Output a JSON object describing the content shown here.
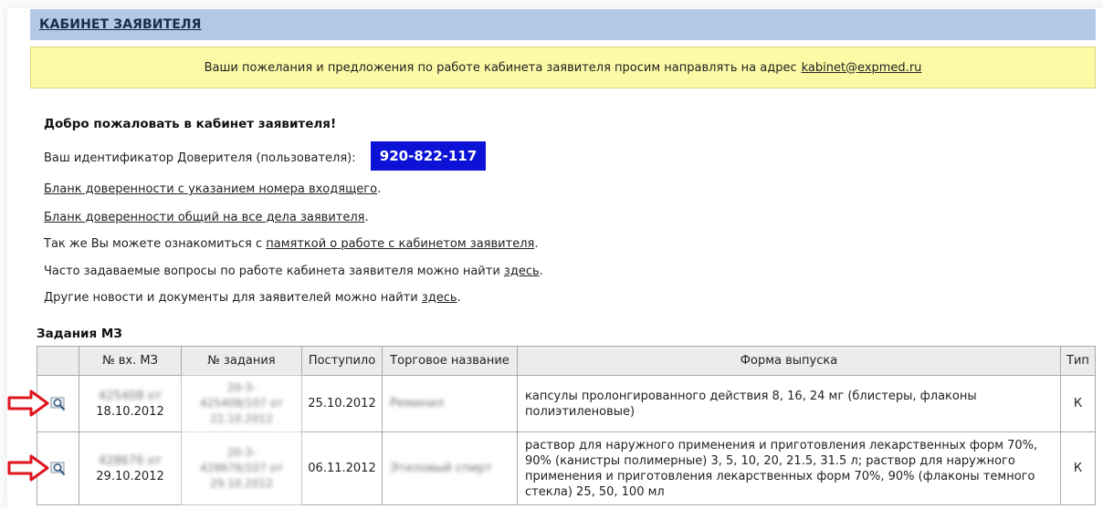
{
  "header": {
    "title": "КАБИНЕТ ЗАЯВИТЕЛЯ"
  },
  "notice": {
    "text": "Ваши пожелания и предложения по работе кабинета заявителя просим направлять на адрес",
    "email": "kabinet@expmed.ru"
  },
  "welcome": "Добро пожаловать в кабинет заявителя!",
  "identifier": {
    "label": "Ваш идентификатор Доверителя (пользователя):",
    "value": "920-822-117"
  },
  "links": {
    "blank_incoming": "Бланк доверенности с указанием номера входящего",
    "blank_general": "Бланк доверенности общий на все дела заявителя",
    "memo_prefix": "Так же Вы можете ознакомиться с",
    "memo_link": "памяткой о работе с кабинетом заявителя",
    "faq_prefix": "Часто задаваемые вопросы по работе кабинета заявителя можно найти",
    "faq_link": "здесь",
    "news_prefix": "Другие новости и документы для заявителей можно найти",
    "news_link": "здесь",
    "dot": "."
  },
  "tasks": {
    "title": "Задания МЗ",
    "columns": [
      "",
      "№ вх. МЗ",
      "№ задания",
      "Поступило",
      "Торговое название",
      "Форма выпуска",
      "Тип"
    ],
    "rows": [
      {
        "in_num": "425408 от",
        "in_date": "18.10.2012",
        "task_l1": "20-3-",
        "task_l2": "425408/107 от",
        "task_l3": "22.10.2012",
        "received": "25.10.2012",
        "trade_name": "Реминил",
        "form": "капсулы пролонгированного действия 8, 16, 24 мг (блистеры, флаконы полиэтиленовые)",
        "type": "К"
      },
      {
        "in_num": "428676 от",
        "in_date": "29.10.2012",
        "task_l1": "20-3-",
        "task_l2": "428676/107 от",
        "task_l3": "29.10.2012",
        "received": "06.11.2012",
        "trade_name": "Этиловый спирт",
        "form": "раствор для наружного применения и приготовления лекарственных форм 70%, 90% (канистры полимерные) 3, 5, 10, 20, 21.5, 31.5 л; раствор для наружного применения и приготовления лекарственных форм 70%, 90% (флаконы темного стекла) 25, 50, 100 мл",
        "type": "К"
      }
    ]
  },
  "colors": {
    "header_bg": "#b3c9e6",
    "notice_bg": "#fdfaa6",
    "badge_bg": "#0c12d6",
    "arrow": "#e0141c"
  },
  "icons": [
    "magnifier-icon",
    "red-arrow-icon"
  ]
}
